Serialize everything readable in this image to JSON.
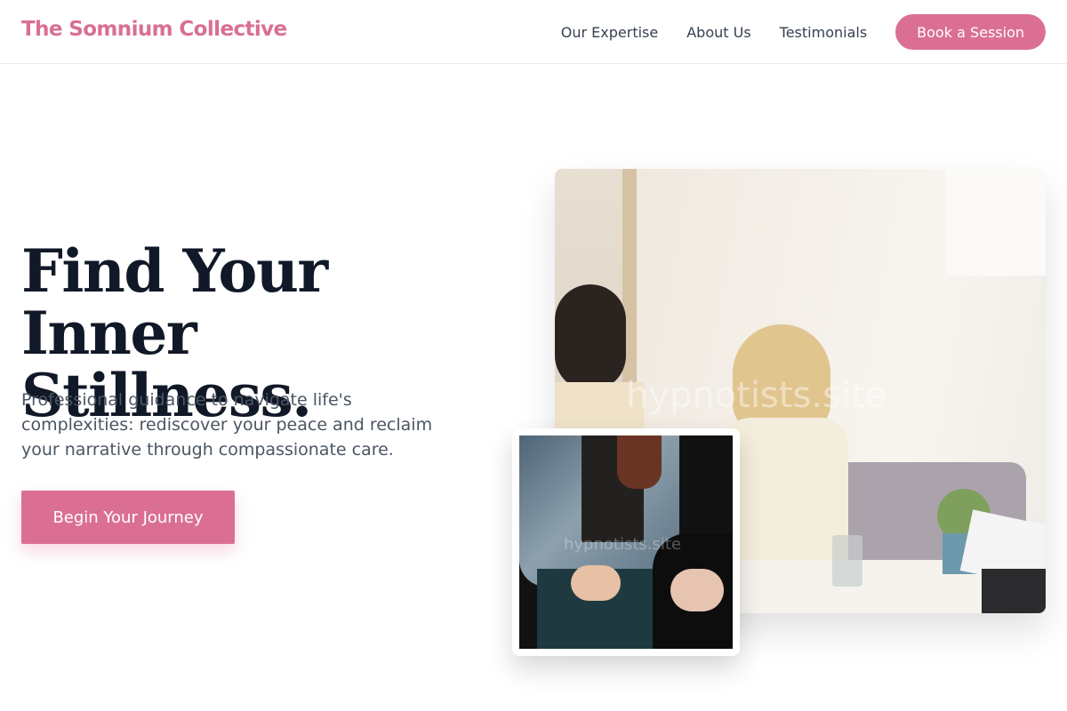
{
  "header": {
    "brand": "The Somnium Collective",
    "nav": [
      {
        "label": "Our Expertise"
      },
      {
        "label": "About Us"
      },
      {
        "label": "Testimonials"
      }
    ],
    "cta_label": "Book a Session"
  },
  "hero": {
    "title_line1": "Find Your Inner",
    "title_line2": "Stillness.",
    "subtitle": "Professional guidance to navigate life's complexities: rediscover your peace and reclaim your narrative through compassionate care.",
    "cta_label": "Begin Your Journey"
  },
  "images": {
    "main_watermark": "hypnotists.site",
    "inset_watermark": "hypnotists.site"
  },
  "colors": {
    "accent": "#da6f93",
    "heading": "#111827",
    "body_text": "#4b5563"
  }
}
